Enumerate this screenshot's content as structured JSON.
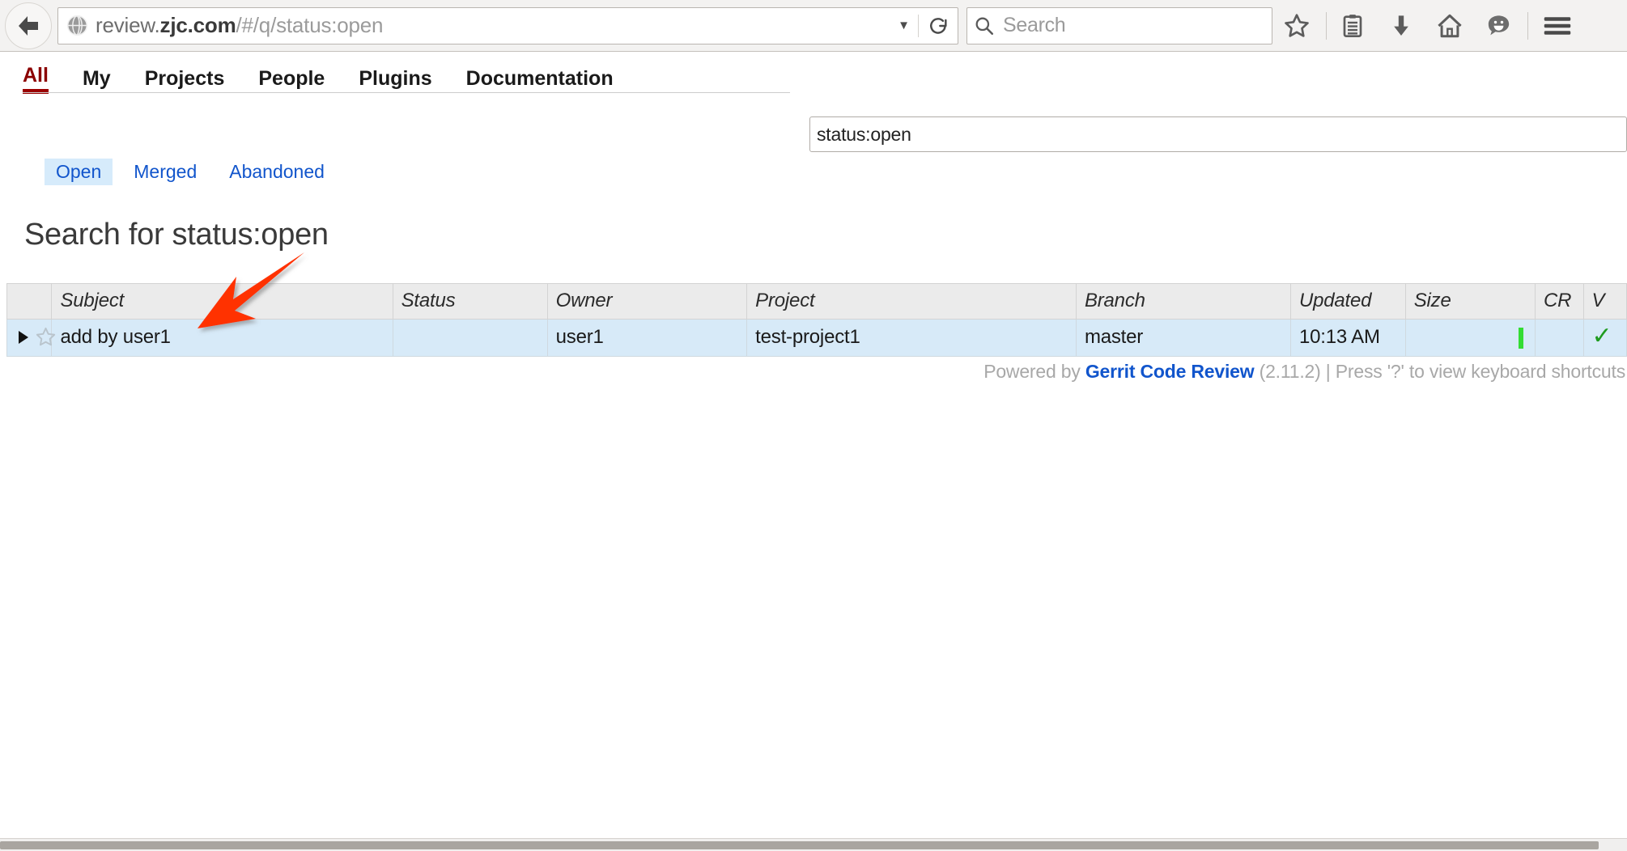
{
  "browser": {
    "back_button": "back-arrow",
    "url": {
      "scheme_host_pre": "review.",
      "host_bold": "zjc.com",
      "path": "/#/q/status:open",
      "full": "review.zjc.com/#/q/status:open"
    },
    "url_dropdown": "▼",
    "reload_label": "reload",
    "search": {
      "placeholder": "Search",
      "value": ""
    },
    "toolbar_icons": [
      "bookmark-star-icon",
      "reader-list-icon",
      "downloads-icon",
      "home-icon",
      "feedback-smiley-icon",
      "hamburger-menu-icon"
    ]
  },
  "gerrit": {
    "main_tabs": [
      {
        "label": "All",
        "active": true
      },
      {
        "label": "My",
        "active": false
      },
      {
        "label": "Projects",
        "active": false
      },
      {
        "label": "People",
        "active": false
      },
      {
        "label": "Plugins",
        "active": false
      },
      {
        "label": "Documentation",
        "active": false
      }
    ],
    "search_box": {
      "value": "status:open",
      "placeholder": "Search"
    },
    "sub_tabs": [
      {
        "label": "Open",
        "active": true
      },
      {
        "label": "Merged",
        "active": false
      },
      {
        "label": "Abandoned",
        "active": false
      }
    ],
    "page_title": "Search for status:open",
    "table": {
      "columns": [
        "",
        "Subject",
        "Status",
        "Owner",
        "Project",
        "Branch",
        "Updated",
        "Size",
        "CR",
        "V"
      ],
      "rows": [
        {
          "expander": "▶",
          "star": "star-outline-icon",
          "subject": "add by user1",
          "status": "",
          "owner": "user1",
          "project": "test-project1",
          "branch": "master",
          "updated": "10:13 AM",
          "size": "size-bar-small",
          "cr": "",
          "v": "✓"
        }
      ]
    },
    "footer": {
      "powered_by": "Powered by ",
      "link": "Gerrit Code Review",
      "version": " (2.11.2) | ",
      "shortcuts": "Press '?' to view keyboard shortcuts"
    }
  },
  "annotation": {
    "arrow_color": "#FF3000",
    "points_to": "add by user1"
  },
  "colors": {
    "active_tab": "#9b0000",
    "link": "#1155cc",
    "row_highlight": "#d7eaf8",
    "header_bg": "#ebebeb",
    "green_check": "#1f9b1f",
    "size_bar": "#33dd33"
  }
}
